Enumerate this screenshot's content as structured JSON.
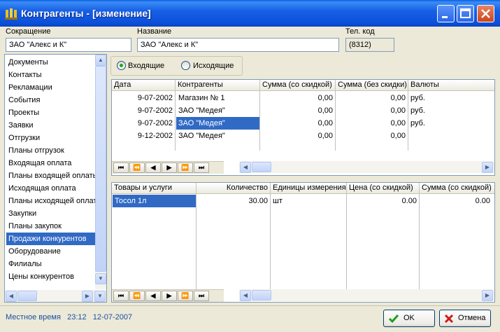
{
  "window": {
    "title": "Контрагенты - [изменение]"
  },
  "fields": {
    "short_label": "Сокращение",
    "short_value": "ЗАО \"Алекс и К\"",
    "name_label": "Название",
    "name_value": "ЗАО \"Алекс и К\"",
    "phone_label": "Тел. код",
    "phone_value": "(8312)"
  },
  "sidebar": {
    "items": [
      "Документы",
      "Контакты",
      "Рекламации",
      "События",
      "Проекты",
      "Заявки",
      "Отгрузки",
      "Планы отгрузок",
      "Входящая оплата",
      "Планы входящей оплаты",
      "Исходящая оплата",
      "Планы исходящей оплаты",
      "Закупки",
      "Планы закупок",
      "Продажи конкурентов",
      "Оборудование",
      "Филиалы",
      "Цены конкурентов"
    ],
    "selected": "Продажи конкурентов"
  },
  "radio": {
    "incoming": "Входящие",
    "outgoing": "Исходящие",
    "selected": "incoming"
  },
  "top_grid": {
    "columns": [
      "Дата",
      "Контрагенты",
      "Сумма (со скидкой)",
      "Сумма (без скидки)",
      "Валюты"
    ],
    "rows": [
      [
        "9-07-2002",
        "Магазин № 1",
        "0,00",
        "0,00",
        "руб."
      ],
      [
        "9-07-2002",
        "ЗАО \"Медея\"",
        "0,00",
        "0,00",
        "руб."
      ],
      [
        "9-07-2002",
        "ЗАО \"Медея\"",
        "0,00",
        "0,00",
        "руб."
      ],
      [
        "9-12-2002",
        "ЗАО \"Медея\"",
        "0,00",
        "0,00",
        ""
      ]
    ]
  },
  "bottom_grid": {
    "columns": [
      "Товары и услуги",
      "Количество",
      "Единицы измерения",
      "Цена (со скидкой)",
      "Сумма (со скидкой)"
    ],
    "rows": [
      [
        "Тосол 1л",
        "30.00",
        "шт",
        "0.00",
        "0.00"
      ]
    ]
  },
  "nav": [
    "⏮",
    "⏪",
    "◀",
    "▶",
    "⏩",
    "⏭"
  ],
  "status": {
    "local_time_label": "Местное время",
    "time": "23:12",
    "date": "12-07-2007"
  },
  "buttons": {
    "ok": "OK",
    "cancel": "Отмена"
  }
}
